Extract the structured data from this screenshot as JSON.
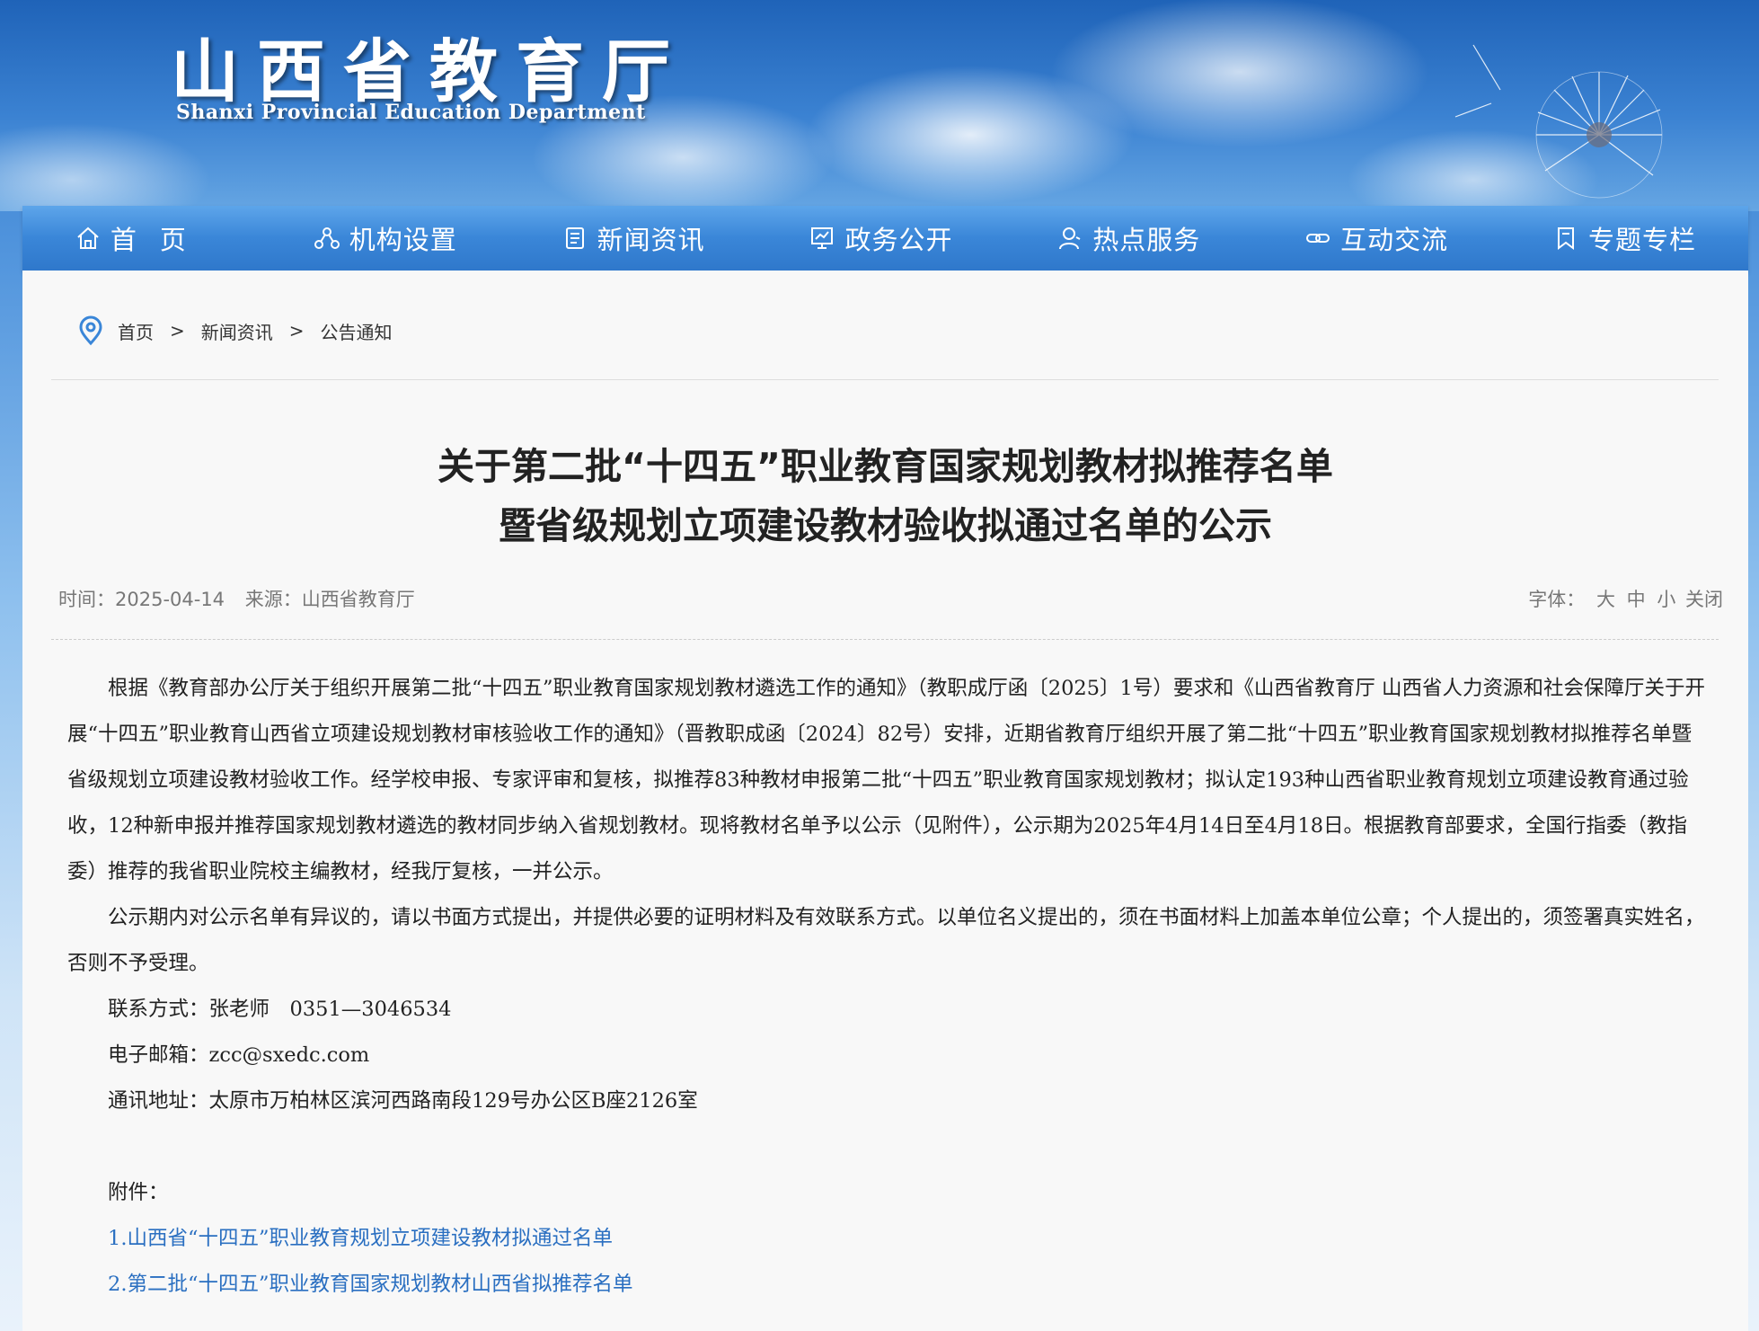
{
  "site": {
    "title": "山西省教育厅",
    "subtitle": "Shanxi Provincial Education Department"
  },
  "nav": {
    "items": [
      {
        "label": "首页",
        "icon": "home-icon"
      },
      {
        "label": "机构设置",
        "icon": "org-structure-icon"
      },
      {
        "label": "新闻资讯",
        "icon": "news-document-icon"
      },
      {
        "label": "政务公开",
        "icon": "gov-chart-icon"
      },
      {
        "label": "热点服务",
        "icon": "service-person-icon"
      },
      {
        "label": "互动交流",
        "icon": "link-chain-icon"
      },
      {
        "label": "专题专栏",
        "icon": "bookmark-icon"
      }
    ]
  },
  "breadcrumb": {
    "items": [
      "首页",
      "新闻资讯",
      "公告通知"
    ],
    "separator": ">"
  },
  "article": {
    "title_line1": "关于第二批“十四五”职业教育国家规划教材拟推荐名单",
    "title_line2": "暨省级规划立项建设教材验收拟通过名单的公示",
    "time_label": "时间：",
    "time": "2025-04-14",
    "source_label": "来源：",
    "source": "山西省教育厅",
    "font_label": "字体：",
    "font_options": [
      "大",
      "中",
      "小",
      "关闭"
    ],
    "paragraphs": [
      "根据《教育部办公厅关于组织开展第二批“十四五”职业教育国家规划教材遴选工作的通知》（教职成厅函〔2025〕1号）要求和《山西省教育厅 山西省人力资源和社会保障厅关于开展“十四五”职业教育山西省立项建设规划教材审核验收工作的通知》（晋教职成函〔2024〕82号）安排，近期省教育厅组织开展了第二批“十四五”职业教育国家规划教材拟推荐名单暨省级规划立项建设教材验收工作。经学校申报、专家评审和复核，拟推荐83种教材申报第二批“十四五”职业教育国家规划教材；拟认定193种山西省职业教育规划立项建设教育通过验收，12种新申报并推荐国家规划教材遴选的教材同步纳入省规划教材。现将教材名单予以公示（见附件），公示期为2025年4月14日至4月18日。根据教育部要求，全国行指委（教指委）推荐的我省职业院校主编教材，经我厅复核，一并公示。",
      "公示期内对公示名单有异议的，请以书面方式提出，并提供必要的证明材料及有效联系方式。以单位名义提出的，须在书面材料上加盖本单位公章；个人提出的，须签署真实姓名，否则不予受理。"
    ],
    "contact": "联系方式：张老师　0351—3046534",
    "email": "电子邮箱：zcc@sxedc.com",
    "address": "通讯地址：太原市万柏林区滨河西路南段129号办公区B座2126室",
    "attachments_label": "附件：",
    "attachments": [
      "1.山西省“十四五”职业教育规划立项建设教材拟通过名单",
      "2.第二批“十四五”职业教育国家规划教材山西省拟推荐名单"
    ]
  },
  "colors": {
    "nav_bg": "#3a86d8",
    "link": "#2a6fc1",
    "text": "#222222",
    "meta": "#777777"
  }
}
